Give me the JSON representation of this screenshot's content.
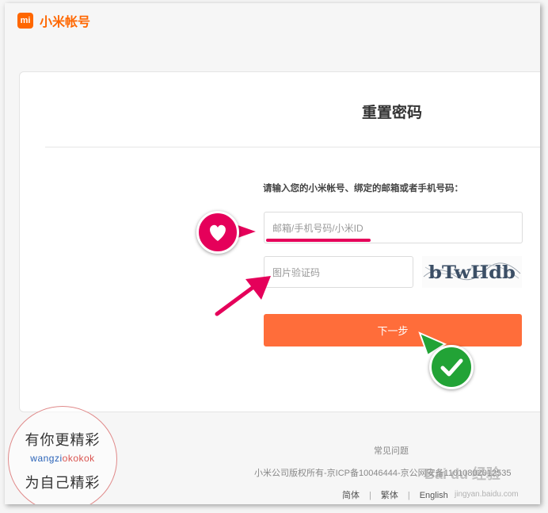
{
  "header": {
    "logo_mark": "mi",
    "logo_text": "小米帐号"
  },
  "form": {
    "title": "重置密码",
    "prompt": "请输入您的小米帐号、绑定的邮箱或者手机号码：",
    "account_placeholder": "邮箱/手机号码/小米ID",
    "captcha_placeholder": "图片验证码",
    "captcha_text": "bTwHdb",
    "next_label": "下一步"
  },
  "footer": {
    "faq": "常见问题",
    "copyright": "小米公司版权所有-京ICP备10046444-京公网安备11010802012535",
    "languages": [
      "简体",
      "繁体",
      "English"
    ],
    "separator": "|"
  },
  "overlay": {
    "watermark_line1": "有你更精彩",
    "watermark_line2": "wangzi",
    "watermark_line2_accent": "okokok",
    "watermark_line3": "为自己精彩",
    "baidu_logo": "Bai du 经验",
    "baidu_url": "jingyan.baidu.com"
  },
  "colors": {
    "brand": "#ff6700",
    "button": "#ff6d3a",
    "highlight": "#e5005a",
    "check": "#22a336"
  },
  "icons": {
    "heart": "heart-icon",
    "check": "check-icon",
    "arrow": "arrow-icon"
  }
}
